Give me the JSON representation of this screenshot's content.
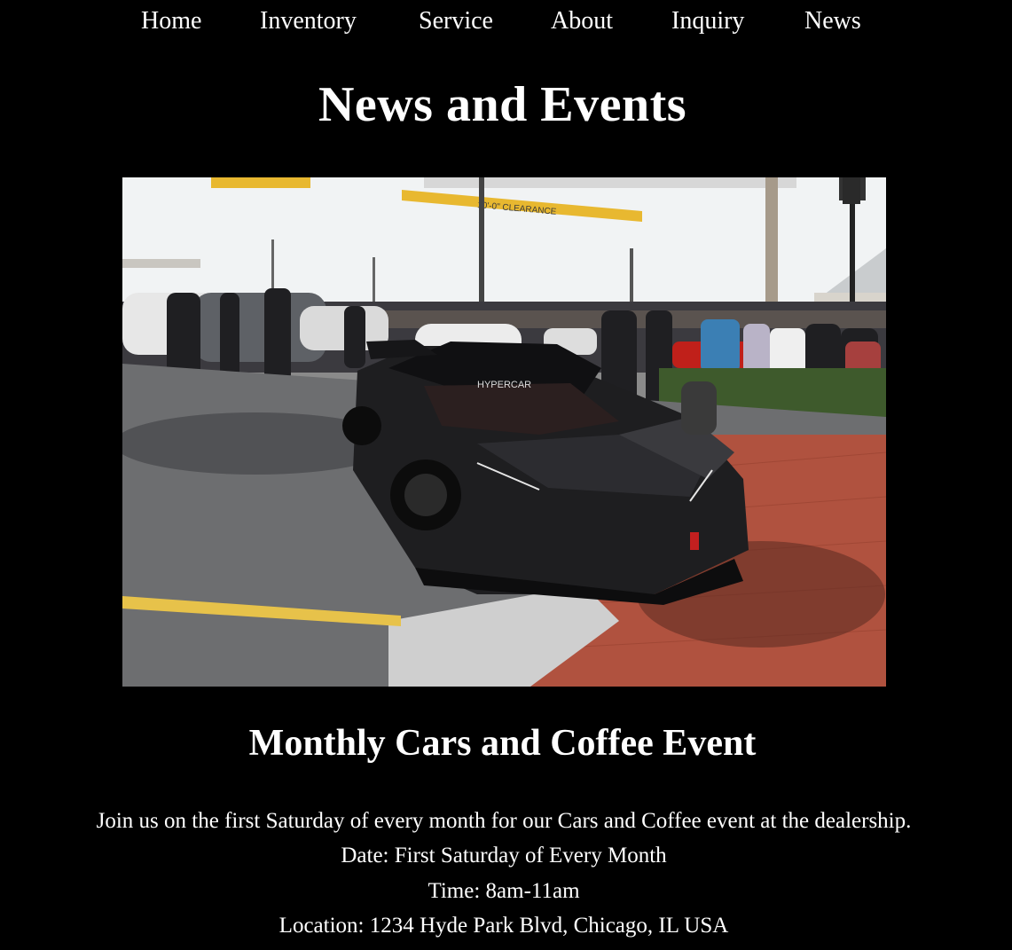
{
  "nav": {
    "items": [
      {
        "label": "Home"
      },
      {
        "label": "Inventory"
      },
      {
        "label": "Service"
      },
      {
        "label": "About"
      },
      {
        "label": "Inquiry"
      },
      {
        "label": "News"
      }
    ]
  },
  "page": {
    "title": "News and Events"
  },
  "event": {
    "title": "Monthly Cars and Coffee Event",
    "description": "Join us on the first Saturday of every month for our Cars and Coffee event at the dealership.",
    "date": "Date: First Saturday of Every Month",
    "time": "Time: 8am-11am",
    "location": "Location: 1234 Hyde Park Blvd, Chicago, IL USA",
    "image": {
      "sign_text": "10'-0\" CLEARANCE",
      "car_windshield_text": "HYPERCAR"
    }
  },
  "colors": {
    "background": "#000000",
    "text": "#ffffff",
    "clearance_sign": "#e8b830",
    "brick": "#b0523f"
  }
}
